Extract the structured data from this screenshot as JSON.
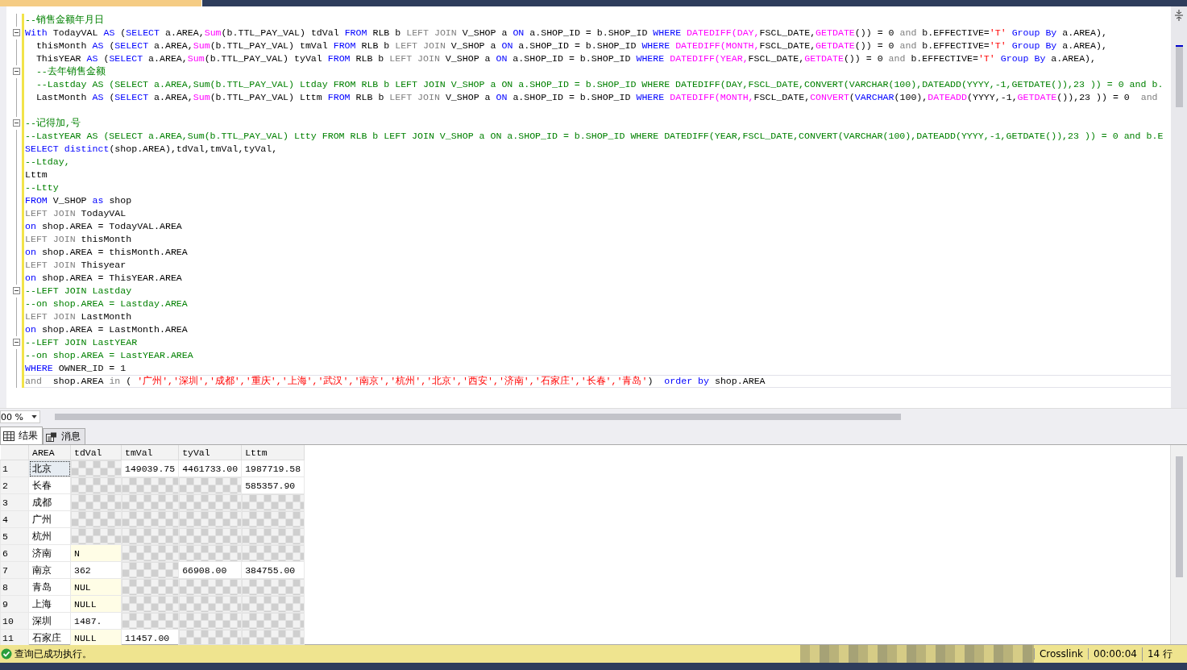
{
  "editor": {
    "lines": [
      {
        "fold": false,
        "current": false,
        "tokens": [
          {
            "kind": "cm",
            "text": "--销售金额年月日"
          }
        ]
      },
      {
        "fold": true,
        "current": false,
        "tokens": [
          {
            "kind": "kw",
            "text": "With"
          },
          {
            "kind": "pl",
            "text": " TodayVAL "
          },
          {
            "kind": "kw",
            "text": "AS"
          },
          {
            "kind": "pl",
            "text": " ("
          },
          {
            "kind": "kw",
            "text": "SELECT"
          },
          {
            "kind": "pl",
            "text": " a.AREA,"
          },
          {
            "kind": "fn",
            "text": "Sum"
          },
          {
            "kind": "pl",
            "text": "(b.TTL_PAY_VAL) tdVal "
          },
          {
            "kind": "kw",
            "text": "FROM"
          },
          {
            "kind": "pl",
            "text": " RLB b "
          },
          {
            "kind": "op",
            "text": "LEFT JOIN"
          },
          {
            "kind": "pl",
            "text": " V_SHOP a "
          },
          {
            "kind": "kw",
            "text": "ON"
          },
          {
            "kind": "pl",
            "text": " a.SHOP_ID = b.SHOP_ID "
          },
          {
            "kind": "kw",
            "text": "WHERE"
          },
          {
            "kind": "fn",
            "text": " DATEDIFF(DAY,"
          },
          {
            "kind": "pl",
            "text": "FSCL_DATE,"
          },
          {
            "kind": "fn",
            "text": "GETDATE"
          },
          {
            "kind": "pl",
            "text": "()) = 0 "
          },
          {
            "kind": "op",
            "text": "and"
          },
          {
            "kind": "pl",
            "text": " b.EFFECTIVE="
          },
          {
            "kind": "str",
            "text": "'T'"
          },
          {
            "kind": "kw",
            "text": " Group By"
          },
          {
            "kind": "pl",
            "text": " a.AREA),"
          }
        ]
      },
      {
        "fold": false,
        "current": false,
        "tokens": [
          {
            "kind": "pl",
            "text": "  thisMonth "
          },
          {
            "kind": "kw",
            "text": "AS"
          },
          {
            "kind": "pl",
            "text": " ("
          },
          {
            "kind": "kw",
            "text": "SELECT"
          },
          {
            "kind": "pl",
            "text": " a.AREA,"
          },
          {
            "kind": "fn",
            "text": "Sum"
          },
          {
            "kind": "pl",
            "text": "(b.TTL_PAY_VAL) tmVal "
          },
          {
            "kind": "kw",
            "text": "FROM"
          },
          {
            "kind": "pl",
            "text": " RLB b "
          },
          {
            "kind": "op",
            "text": "LEFT JOIN"
          },
          {
            "kind": "pl",
            "text": " V_SHOP a "
          },
          {
            "kind": "kw",
            "text": "ON"
          },
          {
            "kind": "pl",
            "text": " a.SHOP_ID = b.SHOP_ID "
          },
          {
            "kind": "kw",
            "text": "WHERE"
          },
          {
            "kind": "fn",
            "text": " DATEDIFF(MONTH,"
          },
          {
            "kind": "pl",
            "text": "FSCL_DATE,"
          },
          {
            "kind": "fn",
            "text": "GETDATE"
          },
          {
            "kind": "pl",
            "text": "()) = 0 "
          },
          {
            "kind": "op",
            "text": "and"
          },
          {
            "kind": "pl",
            "text": " b.EFFECTIVE="
          },
          {
            "kind": "str",
            "text": "'T'"
          },
          {
            "kind": "kw",
            "text": " Group By"
          },
          {
            "kind": "pl",
            "text": " a.AREA),"
          }
        ]
      },
      {
        "fold": false,
        "current": false,
        "tokens": [
          {
            "kind": "pl",
            "text": "  ThisYEAR "
          },
          {
            "kind": "kw",
            "text": "AS"
          },
          {
            "kind": "pl",
            "text": " ("
          },
          {
            "kind": "kw",
            "text": "SELECT"
          },
          {
            "kind": "pl",
            "text": " a.AREA,"
          },
          {
            "kind": "fn",
            "text": "Sum"
          },
          {
            "kind": "pl",
            "text": "(b.TTL_PAY_VAL) tyVal "
          },
          {
            "kind": "kw",
            "text": "FROM"
          },
          {
            "kind": "pl",
            "text": " RLB b "
          },
          {
            "kind": "op",
            "text": "LEFT JOIN"
          },
          {
            "kind": "pl",
            "text": " V_SHOP a "
          },
          {
            "kind": "kw",
            "text": "ON"
          },
          {
            "kind": "pl",
            "text": " a.SHOP_ID = b.SHOP_ID "
          },
          {
            "kind": "kw",
            "text": "WHERE"
          },
          {
            "kind": "fn",
            "text": " DATEDIFF(YEAR,"
          },
          {
            "kind": "pl",
            "text": "FSCL_DATE,"
          },
          {
            "kind": "fn",
            "text": "GETDATE"
          },
          {
            "kind": "pl",
            "text": "()) = 0 "
          },
          {
            "kind": "op",
            "text": "and"
          },
          {
            "kind": "pl",
            "text": " b.EFFECTIVE="
          },
          {
            "kind": "str",
            "text": "'T'"
          },
          {
            "kind": "kw",
            "text": " Group By"
          },
          {
            "kind": "pl",
            "text": " a.AREA),"
          }
        ]
      },
      {
        "fold": true,
        "current": false,
        "tokens": [
          {
            "kind": "cm",
            "text": "  --去年销售金额"
          }
        ]
      },
      {
        "fold": false,
        "current": false,
        "tokens": [
          {
            "kind": "cm",
            "text": "  --Lastday AS (SELECT a.AREA,Sum(b.TTL_PAY_VAL) Ltday FROM RLB b LEFT JOIN V_SHOP a ON a.SHOP_ID = b.SHOP_ID WHERE DATEDIFF(DAY,FSCL_DATE,CONVERT(VARCHAR(100),DATEADD(YYYY,-1,GETDATE()),23 )) = 0 and b."
          }
        ]
      },
      {
        "fold": false,
        "current": false,
        "tokens": [
          {
            "kind": "pl",
            "text": "  LastMonth "
          },
          {
            "kind": "kw",
            "text": "AS"
          },
          {
            "kind": "pl",
            "text": " ("
          },
          {
            "kind": "kw",
            "text": "SELECT"
          },
          {
            "kind": "pl",
            "text": " a.AREA,"
          },
          {
            "kind": "fn",
            "text": "Sum"
          },
          {
            "kind": "pl",
            "text": "(b.TTL_PAY_VAL) Lttm "
          },
          {
            "kind": "kw",
            "text": "FROM"
          },
          {
            "kind": "pl",
            "text": " RLB b "
          },
          {
            "kind": "op",
            "text": "LEFT JOIN"
          },
          {
            "kind": "pl",
            "text": " V_SHOP a "
          },
          {
            "kind": "kw",
            "text": "ON"
          },
          {
            "kind": "pl",
            "text": " a.SHOP_ID = b.SHOP_ID "
          },
          {
            "kind": "kw",
            "text": "WHERE"
          },
          {
            "kind": "fn",
            "text": " DATEDIFF(MONTH,"
          },
          {
            "kind": "pl",
            "text": "FSCL_DATE,"
          },
          {
            "kind": "fn",
            "text": "CONVERT"
          },
          {
            "kind": "pl",
            "text": "("
          },
          {
            "kind": "kw",
            "text": "VARCHAR"
          },
          {
            "kind": "pl",
            "text": "(100),"
          },
          {
            "kind": "fn",
            "text": "DATEADD"
          },
          {
            "kind": "pl",
            "text": "(YYYY,-1,"
          },
          {
            "kind": "fn",
            "text": "GETDATE"
          },
          {
            "kind": "pl",
            "text": "()),23 )) = 0  "
          },
          {
            "kind": "op",
            "text": "and"
          }
        ]
      },
      {
        "fold": false,
        "current": false
      },
      {
        "fold": true,
        "current": false,
        "tokens": [
          {
            "kind": "cm",
            "text": "--记得加,号"
          }
        ]
      },
      {
        "fold": false,
        "current": false,
        "tokens": [
          {
            "kind": "cm",
            "text": "--LastYEAR AS (SELECT a.AREA,Sum(b.TTL_PAY_VAL) Ltty FROM RLB b LEFT JOIN V_SHOP a ON a.SHOP_ID = b.SHOP_ID WHERE DATEDIFF(YEAR,FSCL_DATE,CONVERT(VARCHAR(100),DATEADD(YYYY,-1,GETDATE()),23 )) = 0 and b.E"
          }
        ]
      },
      {
        "fold": false,
        "current": false,
        "tokens": [
          {
            "kind": "kw",
            "text": "SELECT distinct"
          },
          {
            "kind": "pl",
            "text": "(shop.AREA),tdVal,tmVal,tyVal,"
          }
        ]
      },
      {
        "fold": false,
        "current": false,
        "tokens": [
          {
            "kind": "cm",
            "text": "--Ltday,"
          }
        ]
      },
      {
        "fold": false,
        "current": false,
        "tokens": [
          {
            "kind": "pl",
            "text": "Lttm"
          }
        ]
      },
      {
        "fold": false,
        "current": false,
        "tokens": [
          {
            "kind": "cm",
            "text": "--Ltty"
          }
        ]
      },
      {
        "fold": false,
        "current": false,
        "tokens": [
          {
            "kind": "kw",
            "text": "FROM"
          },
          {
            "kind": "pl",
            "text": " V_SHOP "
          },
          {
            "kind": "kw",
            "text": "as"
          },
          {
            "kind": "pl",
            "text": " shop"
          }
        ]
      },
      {
        "fold": false,
        "current": false,
        "tokens": [
          {
            "kind": "op",
            "text": "LEFT JOIN"
          },
          {
            "kind": "pl",
            "text": " TodayVAL"
          }
        ]
      },
      {
        "fold": false,
        "current": false,
        "tokens": [
          {
            "kind": "kw",
            "text": "on"
          },
          {
            "kind": "pl",
            "text": " shop.AREA = TodayVAL.AREA"
          }
        ]
      },
      {
        "fold": false,
        "current": false,
        "tokens": [
          {
            "kind": "op",
            "text": "LEFT JOIN"
          },
          {
            "kind": "pl",
            "text": " thisMonth"
          }
        ]
      },
      {
        "fold": false,
        "current": false,
        "tokens": [
          {
            "kind": "kw",
            "text": "on"
          },
          {
            "kind": "pl",
            "text": " shop.AREA = thisMonth.AREA"
          }
        ]
      },
      {
        "fold": false,
        "current": false,
        "tokens": [
          {
            "kind": "op",
            "text": "LEFT JOIN"
          },
          {
            "kind": "pl",
            "text": " Thisyear"
          }
        ]
      },
      {
        "fold": false,
        "current": false,
        "tokens": [
          {
            "kind": "kw",
            "text": "on"
          },
          {
            "kind": "pl",
            "text": " shop.AREA = ThisYEAR.AREA"
          }
        ]
      },
      {
        "fold": true,
        "current": false,
        "tokens": [
          {
            "kind": "cm",
            "text": "--LEFT JOIN Lastday"
          }
        ]
      },
      {
        "fold": false,
        "current": false,
        "tokens": [
          {
            "kind": "cm",
            "text": "--on shop.AREA = Lastday.AREA"
          }
        ]
      },
      {
        "fold": false,
        "current": false,
        "tokens": [
          {
            "kind": "op",
            "text": "LEFT JOIN"
          },
          {
            "kind": "pl",
            "text": " LastMonth"
          }
        ]
      },
      {
        "fold": false,
        "current": false,
        "tokens": [
          {
            "kind": "kw",
            "text": "on"
          },
          {
            "kind": "pl",
            "text": " shop.AREA = LastMonth.AREA"
          }
        ]
      },
      {
        "fold": true,
        "current": false,
        "tokens": [
          {
            "kind": "cm",
            "text": "--LEFT JOIN LastYEAR"
          }
        ]
      },
      {
        "fold": false,
        "current": false,
        "tokens": [
          {
            "kind": "cm",
            "text": "--on shop.AREA = LastYEAR.AREA"
          }
        ]
      },
      {
        "fold": false,
        "current": false,
        "tokens": [
          {
            "kind": "kw",
            "text": "WHERE"
          },
          {
            "kind": "pl",
            "text": " OWNER_ID = 1"
          }
        ]
      },
      {
        "fold": false,
        "current": true,
        "tokens": [
          {
            "kind": "op",
            "text": "and"
          },
          {
            "kind": "pl",
            "text": "  shop.AREA "
          },
          {
            "kind": "op",
            "text": "in"
          },
          {
            "kind": "pl",
            "text": " ( "
          },
          {
            "kind": "str",
            "text": "'广州','深圳','成都','重庆','上海','武汉','南京','杭州','北京','西安','济南','石家庄','长春','青岛'"
          },
          {
            "kind": "pl",
            "text": ")  "
          },
          {
            "kind": "kw",
            "text": "order by"
          },
          {
            "kind": "pl",
            "text": " shop.AREA"
          }
        ]
      }
    ]
  },
  "zoom": {
    "value": "00 %"
  },
  "result_tabs": [
    {
      "label": "结果",
      "selected": true,
      "kind": "grid"
    },
    {
      "label": "消息",
      "selected": false,
      "kind": "messages"
    }
  ],
  "grid": {
    "columns": [
      "AREA",
      "tdVal",
      "tmVal",
      "tyVal",
      "Lttm"
    ],
    "rows": [
      {
        "number": "1",
        "selected": true,
        "cells": [
          {
            "hidden": false,
            "null": false,
            "text": "北京"
          },
          {
            "hidden": true
          },
          {
            "hidden": false,
            "null": false,
            "text": "149039.75"
          },
          {
            "hidden": false,
            "null": false,
            "text": "4461733.00"
          },
          {
            "hidden": false,
            "null": false,
            "text": "1987719.58"
          }
        ]
      },
      {
        "number": "2",
        "selected": false,
        "cells": [
          {
            "hidden": false,
            "null": false,
            "text": "长春"
          },
          {
            "hidden": true
          },
          {
            "hidden": true
          },
          {
            "hidden": true
          },
          {
            "hidden": false,
            "null": false,
            "text": "585357.90"
          }
        ]
      },
      {
        "number": "3",
        "selected": false,
        "cells": [
          {
            "hidden": false,
            "null": false,
            "text": "成都"
          },
          {
            "hidden": true
          },
          {
            "hidden": true
          },
          {
            "hidden": true
          },
          {
            "hidden": true
          }
        ]
      },
      {
        "number": "4",
        "selected": false,
        "cells": [
          {
            "hidden": false,
            "null": false,
            "text": "广州"
          },
          {
            "hidden": true
          },
          {
            "hidden": true
          },
          {
            "hidden": true
          },
          {
            "hidden": true
          }
        ]
      },
      {
        "number": "5",
        "selected": false,
        "cells": [
          {
            "hidden": false,
            "null": false,
            "text": "杭州"
          },
          {
            "hidden": true
          },
          {
            "hidden": true
          },
          {
            "hidden": true
          },
          {
            "hidden": true
          }
        ]
      },
      {
        "number": "6",
        "selected": false,
        "cells": [
          {
            "hidden": false,
            "null": false,
            "text": "济南"
          },
          {
            "hidden": false,
            "null": true,
            "text": "N"
          },
          {
            "hidden": true
          },
          {
            "hidden": true
          },
          {
            "hidden": true
          }
        ]
      },
      {
        "number": "7",
        "selected": false,
        "cells": [
          {
            "hidden": false,
            "null": false,
            "text": "南京"
          },
          {
            "hidden": false,
            "null": false,
            "text": "362"
          },
          {
            "hidden": true
          },
          {
            "hidden": false,
            "null": false,
            "text": "66908.00"
          },
          {
            "hidden": false,
            "null": false,
            "text": "384755.00"
          }
        ]
      },
      {
        "number": "8",
        "selected": false,
        "cells": [
          {
            "hidden": false,
            "null": false,
            "text": "青岛"
          },
          {
            "hidden": false,
            "null": true,
            "text": "NUL"
          },
          {
            "hidden": true
          },
          {
            "hidden": true
          },
          {
            "hidden": true
          }
        ]
      },
      {
        "number": "9",
        "selected": false,
        "cells": [
          {
            "hidden": false,
            "null": false,
            "text": "上海"
          },
          {
            "hidden": false,
            "null": true,
            "text": "NULL"
          },
          {
            "hidden": true
          },
          {
            "hidden": true
          },
          {
            "hidden": true
          }
        ]
      },
      {
        "number": "10",
        "selected": false,
        "cells": [
          {
            "hidden": false,
            "null": false,
            "text": "深圳"
          },
          {
            "hidden": false,
            "null": false,
            "text": "1487."
          },
          {
            "hidden": true
          },
          {
            "hidden": true
          },
          {
            "hidden": true
          }
        ]
      },
      {
        "number": "11",
        "selected": false,
        "cells": [
          {
            "hidden": false,
            "null": false,
            "text": "石家庄"
          },
          {
            "hidden": false,
            "null": true,
            "text": "NULL"
          },
          {
            "hidden": false,
            "null": false,
            "text": "11457.00"
          },
          {
            "hidden": true
          },
          {
            "hidden": true
          }
        ]
      }
    ]
  },
  "status_bar": {
    "message": "查询已成功执行。",
    "database": "Crosslink",
    "elapsed": "00:00:04",
    "rows": "14 行"
  }
}
